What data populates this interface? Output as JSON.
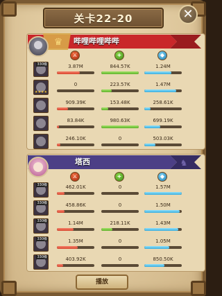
{
  "title": "关卡22-20",
  "buttons": {
    "close_label": "✕",
    "play_label": "播放"
  },
  "teams": [
    {
      "name": "哔哩哔哩哔哔",
      "heroes": [
        {
          "level": "330级",
          "stars": "",
          "damage": "3.87M",
          "heal": "844.57K",
          "tank": "1.24M",
          "damage_pct": 0.62,
          "heal_pct": 1.0,
          "tank_pct": 0.72
        },
        {
          "level": "",
          "stars": "★★★★",
          "damage": "0",
          "heal": "223.57K",
          "tank": "1.47M",
          "damage_pct": 0.0,
          "heal_pct": 0.27,
          "tank_pct": 0.85
        },
        {
          "level": "",
          "stars": "",
          "damage": "909.39K",
          "heal": "153.48K",
          "tank": "258.61K",
          "damage_pct": 0.3,
          "heal_pct": 0.19,
          "tank_pct": 0.16
        },
        {
          "level": "",
          "stars": "",
          "damage": "83.84K",
          "heal": "980.63K",
          "tank": "699.19K",
          "damage_pct": 0.05,
          "heal_pct": 1.0,
          "tank_pct": 0.42
        },
        {
          "level": "",
          "stars": "",
          "damage": "246.10K",
          "heal": "0",
          "tank": "503.03K",
          "damage_pct": 0.1,
          "heal_pct": 0.0,
          "tank_pct": 0.3
        }
      ]
    },
    {
      "name": "塔西",
      "heroes": [
        {
          "level": "330级",
          "stars": "",
          "damage": "462.01K",
          "heal": "0",
          "tank": "1.57M",
          "damage_pct": 0.2,
          "heal_pct": 0.0,
          "tank_pct": 1.0
        },
        {
          "level": "330级",
          "stars": "",
          "damage": "458.86K",
          "heal": "0",
          "tank": "1.50M",
          "damage_pct": 0.2,
          "heal_pct": 0.0,
          "tank_pct": 0.95
        },
        {
          "level": "330级",
          "stars": "",
          "damage": "1.14M",
          "heal": "218.11K",
          "tank": "1.43M",
          "damage_pct": 0.45,
          "heal_pct": 0.3,
          "tank_pct": 0.9
        },
        {
          "level": "330级",
          "stars": "",
          "damage": "1.35M",
          "heal": "0",
          "tank": "1.05M",
          "damage_pct": 0.55,
          "heal_pct": 0.0,
          "tank_pct": 0.66
        },
        {
          "level": "330级",
          "stars": "",
          "damage": "403.92K",
          "heal": "0",
          "tank": "850.50K",
          "damage_pct": 0.17,
          "heal_pct": 0.0,
          "tank_pct": 0.54
        }
      ]
    }
  ],
  "colors": {
    "damage": "#d8452d",
    "heal": "#5fb32a",
    "tank": "#39aede",
    "banner_red": "#c9272a",
    "banner_blue": "#4c3f86"
  }
}
